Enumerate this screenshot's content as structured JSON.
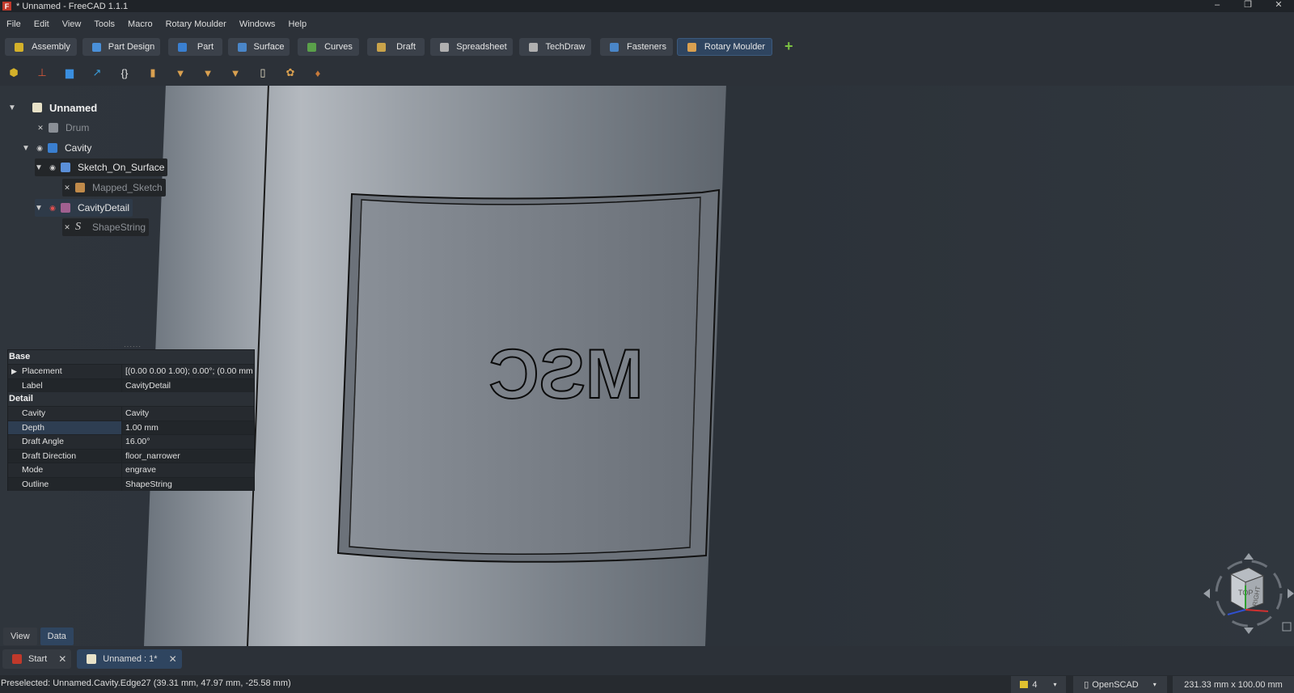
{
  "window": {
    "title": "* Unnamed - FreeCAD 1.1.1",
    "app_icon": "freecad-icon",
    "controls": [
      "–",
      "❐",
      "✕"
    ]
  },
  "menu": [
    "File",
    "Edit",
    "View",
    "Tools",
    "Macro",
    "Rotary Moulder",
    "Windows",
    "Help"
  ],
  "workbenches": [
    {
      "label": "Assembly",
      "icon": "assembly-icon",
      "color": "#d4b12a"
    },
    {
      "label": "Part Design",
      "icon": "part-design-icon",
      "color": "#4a90d9"
    },
    {
      "label": "Part",
      "icon": "part-icon",
      "color": "#3a7fd0"
    },
    {
      "label": "Surface",
      "icon": "surface-icon",
      "color": "#4a86c8"
    },
    {
      "label": "Curves",
      "icon": "curves-icon",
      "color": "#5aa04a"
    },
    {
      "label": "Draft",
      "icon": "draft-icon",
      "color": "#c9a34a"
    },
    {
      "label": "Spreadsheet",
      "icon": "spreadsheet-icon",
      "color": "#b0b0b0"
    },
    {
      "label": "TechDraw",
      "icon": "techdraw-icon",
      "color": "#b0b0b0"
    },
    {
      "label": "Fasteners",
      "icon": "fasteners-icon",
      "color": "#4a86c8"
    },
    {
      "label": "Rotary Moulder",
      "icon": "rotary-moulder-icon",
      "color": "#d9a050",
      "active": true
    }
  ],
  "add_workbench": "+",
  "toolbar_icons": [
    "new-part-icon",
    "axis-icon",
    "folder-icon",
    "export-icon",
    "braces-icon",
    "box-icon",
    "mould-icon-1",
    "mould-icon-2",
    "mould-icon-3",
    "document-icon",
    "gear-icon",
    "pin-icon"
  ],
  "tree": {
    "items": [
      {
        "label": "Unnamed",
        "icon": "document-icon"
      },
      {
        "label": "Drum",
        "icon": "solid-icon"
      },
      {
        "label": "Cavity",
        "icon": "cavity-icon"
      },
      {
        "label": "Sketch_On_Surface",
        "icon": "sketch-surface-icon"
      },
      {
        "label": "Mapped_Sketch",
        "icon": "mapped-sketch-icon"
      },
      {
        "label": "CavityDetail",
        "icon": "cavity-detail-icon"
      },
      {
        "label": "ShapeString",
        "icon": "shapestring-icon",
        "glyph": "S"
      }
    ]
  },
  "properties": {
    "groups": [
      {
        "name": "Base",
        "rows": [
          {
            "name": "Placement",
            "value": "[(0.00 0.00 1.00); 0.00°; (0.00 mm  0..."
          },
          {
            "name": "Label",
            "value": "CavityDetail"
          }
        ]
      },
      {
        "name": "Detail",
        "rows": [
          {
            "name": "Cavity",
            "value": "Cavity"
          },
          {
            "name": "Depth",
            "value": "1.00 mm"
          },
          {
            "name": "Draft Angle",
            "value": "16.00°"
          },
          {
            "name": "Draft Direction",
            "value": "floor_narrower"
          },
          {
            "name": "Mode",
            "value": "engrave"
          },
          {
            "name": "Outline",
            "value": "ShapeString"
          }
        ]
      }
    ]
  },
  "panel_tabs": [
    "View",
    "Data"
  ],
  "document_tabs": [
    {
      "label": "Start",
      "icon": "freecad-icon"
    },
    {
      "label": "Unnamed : 1*",
      "icon": "document-icon"
    }
  ],
  "viewport": {
    "engraved_text": "MSC",
    "navcube": {
      "top": "TOP",
      "right": "RIGHT"
    }
  },
  "status": {
    "preselected": "Preselected: Unnamed.Cavity.Edge27 (39.31 mm, 47.97 mm, -25.58 mm)",
    "layers": "4",
    "nav_style": "OpenSCAD",
    "dimensions": "231.33 mm x 100.00 mm"
  }
}
